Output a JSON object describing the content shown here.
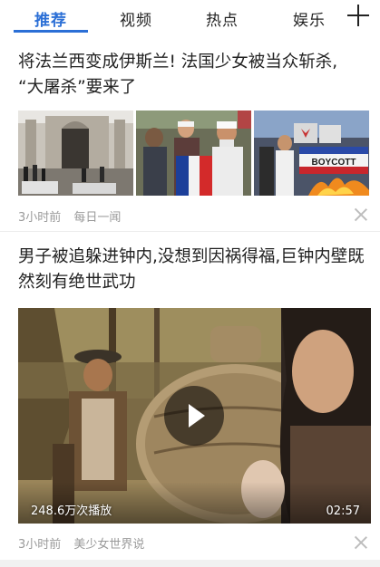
{
  "tabs": [
    {
      "label": "推荐",
      "active": true
    },
    {
      "label": "视频",
      "active": false
    },
    {
      "label": "热点",
      "active": false
    },
    {
      "label": "娱乐",
      "active": false
    }
  ],
  "accent_color": "#2b6fd6",
  "articles": [
    {
      "title_line1": "将法兰西变成伊斯兰! 法国少女被当众斩杀,",
      "title_line2": "“大屠杀”要来了",
      "time": "3小时前",
      "source": "每日一闻",
      "image_sign_text": "BOYCOTT"
    },
    {
      "title_line1": "男子被追躲进钟内,没想到因祸得福,巨钟内壁既",
      "title_line2": "然刻有绝世武功",
      "time": "3小时前",
      "source": "美少女世界说",
      "play_count": "248.6万次播放",
      "duration": "02:57"
    }
  ]
}
